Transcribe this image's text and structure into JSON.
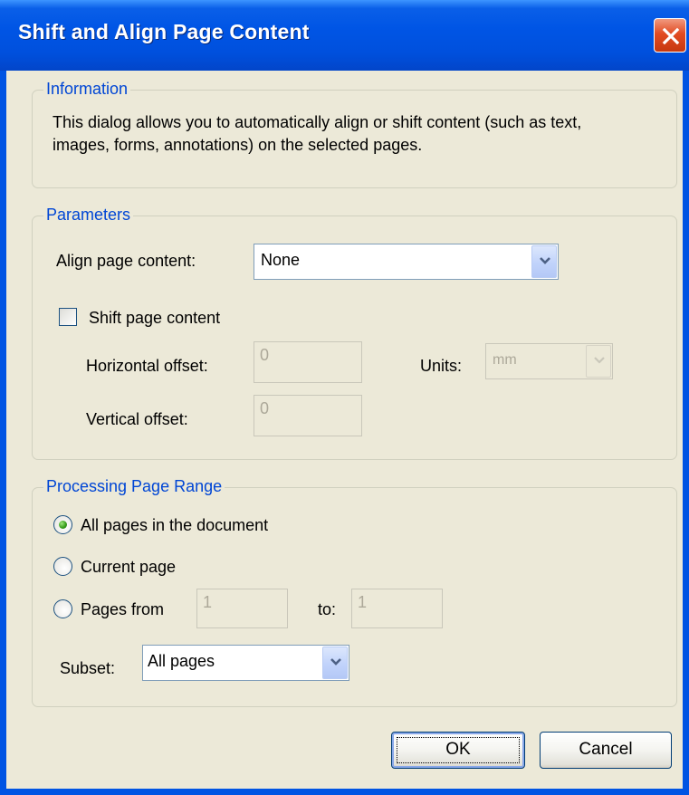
{
  "window": {
    "title": "Shift and Align Page Content"
  },
  "information": {
    "legend": "Information",
    "text": "This dialog allows you to automatically align or shift content (such as text, images, forms, annotations) on the selected pages."
  },
  "parameters": {
    "legend": "Parameters",
    "align_label": "Align page content:",
    "align_value": "None",
    "shift_label": "Shift page content",
    "shift_checked": false,
    "horizontal_label": "Horizontal offset:",
    "horizontal_value": "0",
    "vertical_label": "Vertical offset:",
    "vertical_value": "0",
    "units_label": "Units:",
    "units_value": "mm"
  },
  "page_range": {
    "legend": "Processing Page Range",
    "all_pages_label": "All pages in the document",
    "current_page_label": "Current page",
    "pages_from_label": "Pages from",
    "from_value": "1",
    "to_label": "to:",
    "to_value": "1",
    "selected": "all_pages",
    "subset_label": "Subset:",
    "subset_value": "All pages"
  },
  "buttons": {
    "ok": "OK",
    "cancel": "Cancel"
  }
}
